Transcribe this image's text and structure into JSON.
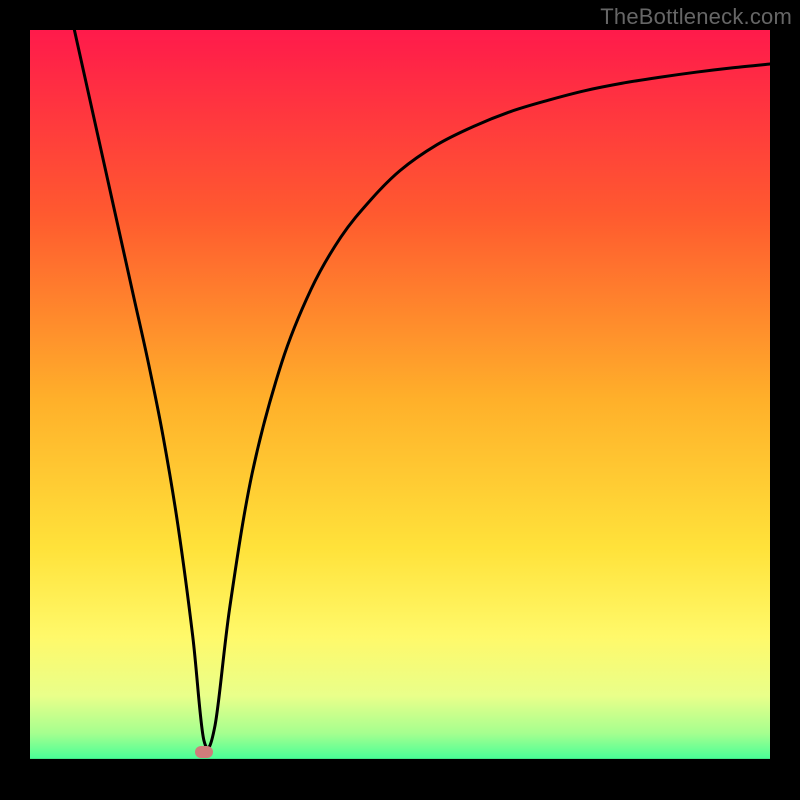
{
  "watermark": "TheBottleneck.com",
  "chart_data": {
    "type": "line",
    "title": "",
    "xlabel": "",
    "ylabel": "",
    "xlim": [
      0,
      100
    ],
    "ylim": [
      0,
      100
    ],
    "gradient_stops": [
      {
        "offset": 0.0,
        "color": "#ff1a4b"
      },
      {
        "offset": 0.25,
        "color": "#ff5a2f"
      },
      {
        "offset": 0.5,
        "color": "#ffb02a"
      },
      {
        "offset": 0.7,
        "color": "#ffe23a"
      },
      {
        "offset": 0.82,
        "color": "#fff96a"
      },
      {
        "offset": 0.9,
        "color": "#e9ff8a"
      },
      {
        "offset": 0.95,
        "color": "#a6ff8f"
      },
      {
        "offset": 1.0,
        "color": "#20ff9a"
      }
    ],
    "black_band": {
      "y_from": 98.5,
      "y_to": 100
    },
    "series": [
      {
        "name": "curve",
        "x": [
          6,
          8,
          10,
          12,
          14,
          16,
          18,
          20,
          22,
          23.5,
          25,
          27,
          30,
          34,
          38,
          42,
          46,
          50,
          55,
          60,
          65,
          70,
          75,
          80,
          85,
          90,
          95,
          100
        ],
        "y": [
          100,
          91,
          82,
          73,
          64,
          55,
          45,
          33,
          18,
          4,
          6,
          22,
          40,
          55,
          65,
          72,
          77,
          81,
          84.5,
          87,
          89,
          90.5,
          91.8,
          92.8,
          93.6,
          94.3,
          94.9,
          95.4
        ]
      }
    ],
    "marker": {
      "x": 23.5,
      "y": 2.5,
      "color": "#cf7d7b"
    }
  }
}
